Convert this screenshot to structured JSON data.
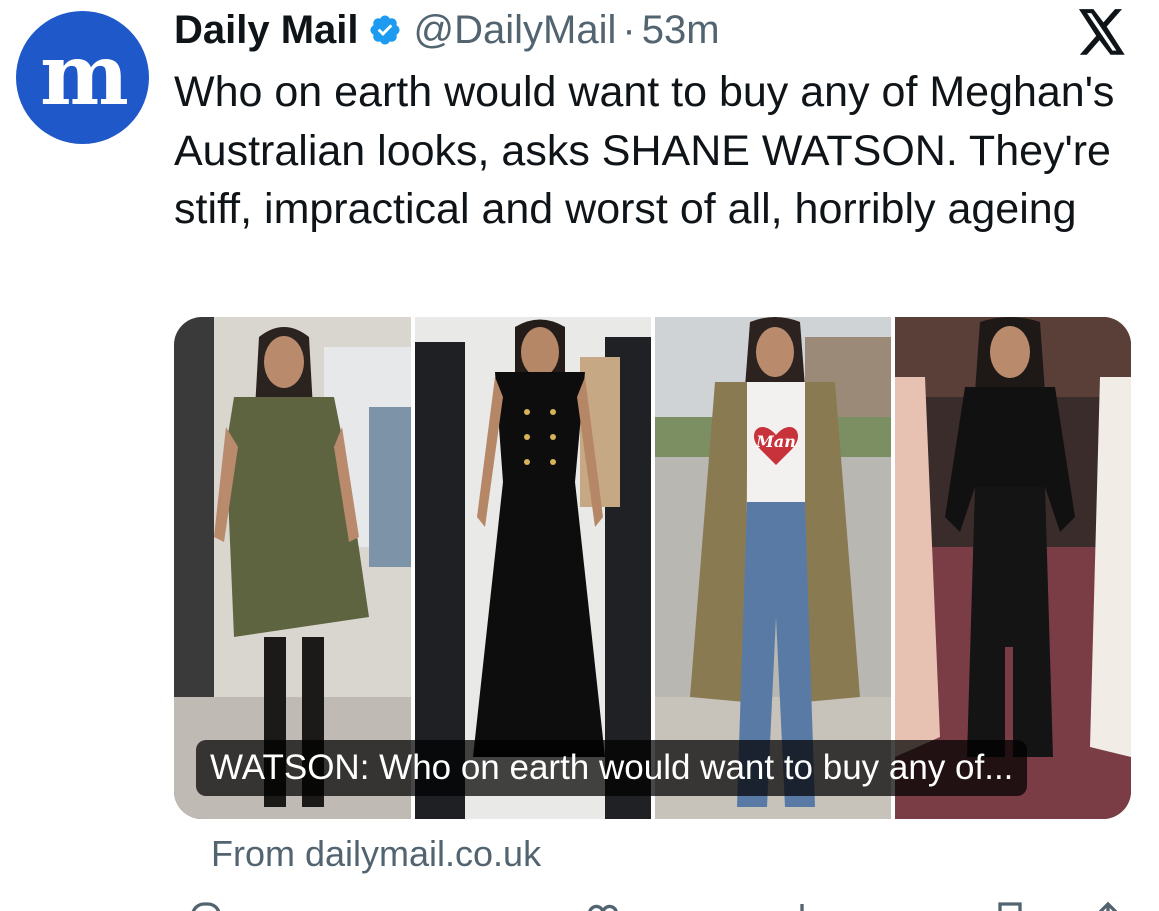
{
  "tweet": {
    "author_name": "Daily Mail",
    "avatar_letter": "m",
    "handle": "@DailyMail",
    "separator": "·",
    "time": "53m",
    "text": "Who on earth would want to buy any of Meghan's Australian looks, asks SHANE WATSON. They're stiff, impractical and worst of all, horribly ageing"
  },
  "card": {
    "title": "WATSON: Who on earth would want to buy any of...",
    "images": [
      {
        "outfit": "olive-shift-dress"
      },
      {
        "outfit": "black-buttoned-dress"
      },
      {
        "outfit": "trench-coat-jeans",
        "shirt_text": "Man"
      },
      {
        "outfit": "black-blouse-skirt"
      }
    ]
  },
  "source": "From dailymail.co.uk",
  "icons": {
    "verified": "verified-badge-icon",
    "platform": "x-logo-icon",
    "actions": [
      "reply-icon",
      "repost-icon",
      "like-icon",
      "views-icon",
      "bookmark-icon",
      "share-icon"
    ]
  },
  "colors": {
    "avatar_bg": "#1e58c9",
    "verified_blue": "#1d9bf0",
    "secondary_text": "#536471"
  }
}
